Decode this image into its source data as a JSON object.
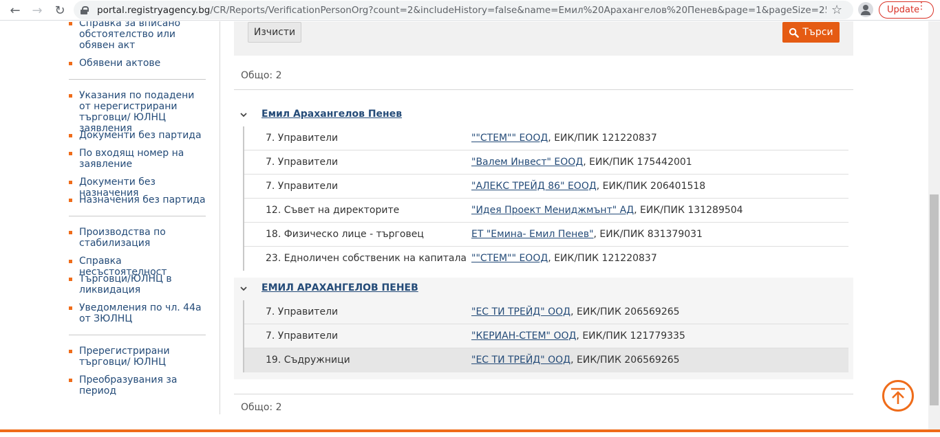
{
  "browser": {
    "url_host": "portal.registryagency.bg",
    "url_path": "/CR/Reports/VerificationPersonOrg?count=2&includeHistory=false&name=Емил%20Арахангелов%20Пенев&page=1&pageSize=25&selected...",
    "update_label": "Update",
    "dots": "⋮"
  },
  "sidebar": {
    "items": [
      {
        "label": "Справка за вписано обстоятелство или обявен акт"
      },
      {
        "label": "Обявени актове"
      },
      {
        "label": "Указания по подадени от нерегистрирани търговци/ ЮЛНЦ заявления"
      },
      {
        "label": "Документи без партида"
      },
      {
        "label": "По входящ номер на заявление"
      },
      {
        "label": "Документи без назначения"
      },
      {
        "label": "Назначения без партида"
      },
      {
        "label": "Производства по стабилизация"
      },
      {
        "label": "Справка несъстоятелност"
      },
      {
        "label": "Търговци/ЮЛНЦ в ликвидация"
      },
      {
        "label": "Уведомления по чл. 44а от ЗЮЛНЦ"
      },
      {
        "label": "Пререгистрирани търговци/ ЮЛНЦ"
      },
      {
        "label": "Преобразувания за период"
      }
    ]
  },
  "search": {
    "clear_label": "Изчисти",
    "search_label": "Търси"
  },
  "total_label": "Общо: 2",
  "persons": [
    {
      "name": "Емил Арахангелов Пенев",
      "rows": [
        {
          "role": "7. Управители",
          "org": "\"\"СТЕМ\"\" ЕООД",
          "eik": ", ЕИК/ПИК 121220837"
        },
        {
          "role": "7. Управители",
          "org": "\"Валем Инвест\" ЕООД",
          "eik": ", ЕИК/ПИК 175442001"
        },
        {
          "role": "7. Управители",
          "org": "\"АЛЕКС ТРЕЙД 86\" ЕООД",
          "eik": ", ЕИК/ПИК 206401518"
        },
        {
          "role": "12. Съвет на директорите",
          "org": "\"Идея Проект Мениджмънт\" АД",
          "eik": ", ЕИК/ПИК 131289504"
        },
        {
          "role": "18. Физическо лице - търговец",
          "org": "ЕТ \"Емина- Емил Пенев\"",
          "eik": ", ЕИК/ПИК 831379031"
        },
        {
          "role": "23. Едноличен собственик на капитала",
          "org": "\"\"СТЕМ\"\" ЕООД",
          "eik": ", ЕИК/ПИК 121220837"
        }
      ]
    },
    {
      "name": "ЕМИЛ АРАХАНГЕЛОВ ПЕНЕВ",
      "rows": [
        {
          "role": "7. Управители",
          "org": "\"ЕС ТИ ТРЕЙД\" ООД",
          "eik": ", ЕИК/ПИК 206569265"
        },
        {
          "role": "7. Управители",
          "org": "\"КЕРИАН-СТЕМ\" ООД",
          "eik": ", ЕИК/ПИК 121779335"
        },
        {
          "role": "19. Съдружници",
          "org": "\"ЕС ТИ ТРЕЙД\" ООД",
          "eik": ", ЕИК/ПИК 206569265"
        }
      ]
    }
  ],
  "colors": {
    "accent": "#ef6c1a",
    "link": "#244b78"
  }
}
